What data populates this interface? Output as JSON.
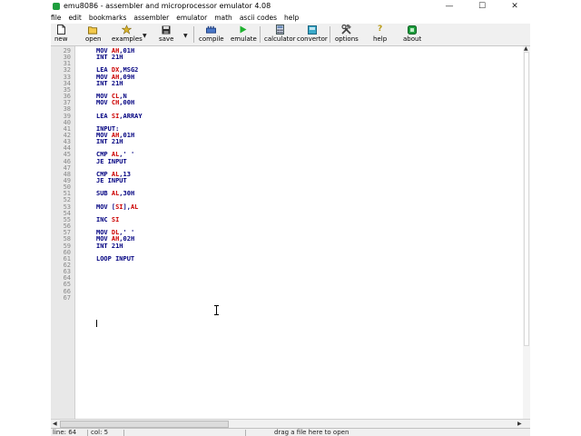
{
  "window": {
    "title": "emu8086 - assembler and microprocessor emulator 4.08",
    "minimize_glyph": "—",
    "maximize_glyph": "☐",
    "close_glyph": "✕"
  },
  "menu": [
    "file",
    "edit",
    "bookmarks",
    "assembler",
    "emulator",
    "math",
    "ascii codes",
    "help"
  ],
  "toolbar": {
    "new": "new",
    "open": "open",
    "examples": "examples",
    "save": "save",
    "compile": "compile",
    "emulate": "emulate",
    "calculator": "calculator",
    "convertor": "convertor",
    "options": "options",
    "help": "help",
    "about": "about",
    "dropdown_glyph": "▼"
  },
  "editor": {
    "lines": [
      {
        "num": "29",
        "text": "MOV AH,01H"
      },
      {
        "num": "30",
        "text": "INT 21H"
      },
      {
        "num": "31",
        "text": ""
      },
      {
        "num": "32",
        "text": "LEA DX,MSG2"
      },
      {
        "num": "33",
        "text": "MOV AH,09H"
      },
      {
        "num": "34",
        "text": "INT 21H"
      },
      {
        "num": "35",
        "text": ""
      },
      {
        "num": "36",
        "text": "MOV CL,N"
      },
      {
        "num": "37",
        "text": "MOV CH,00H"
      },
      {
        "num": "38",
        "text": ""
      },
      {
        "num": "39",
        "text": "LEA SI,ARRAY"
      },
      {
        "num": "40",
        "text": ""
      },
      {
        "num": "41",
        "text": "INPUT:"
      },
      {
        "num": "42",
        "text": "MOV AH,01H"
      },
      {
        "num": "43",
        "text": "INT 21H"
      },
      {
        "num": "44",
        "text": ""
      },
      {
        "num": "45",
        "text": "CMP AL,' '"
      },
      {
        "num": "46",
        "text": "JE INPUT"
      },
      {
        "num": "47",
        "text": ""
      },
      {
        "num": "48",
        "text": "CMP AL,13"
      },
      {
        "num": "49",
        "text": "JE INPUT"
      },
      {
        "num": "50",
        "text": ""
      },
      {
        "num": "51",
        "text": "SUB AL,30H"
      },
      {
        "num": "52",
        "text": ""
      },
      {
        "num": "53",
        "text": "MOV [SI],AL"
      },
      {
        "num": "54",
        "text": ""
      },
      {
        "num": "55",
        "text": "INC SI"
      },
      {
        "num": "56",
        "text": ""
      },
      {
        "num": "57",
        "text": "MOV DL,' '"
      },
      {
        "num": "58",
        "text": "MOV AH,02H"
      },
      {
        "num": "59",
        "text": "INT 21H"
      },
      {
        "num": "60",
        "text": ""
      },
      {
        "num": "61",
        "text": "LOOP INPUT"
      },
      {
        "num": "62",
        "text": ""
      },
      {
        "num": "63",
        "text": ""
      },
      {
        "num": "64",
        "text": ""
      },
      {
        "num": "65",
        "text": ""
      },
      {
        "num": "66",
        "text": ""
      },
      {
        "num": "67",
        "text": ""
      }
    ]
  },
  "scroll": {
    "up_glyph": "▲",
    "left_glyph": "◀",
    "right_glyph": "▶"
  },
  "status": {
    "line": "line: 64",
    "col": "col: 5",
    "hint": "drag a file here to open"
  },
  "colors": {
    "keyword": "#000080",
    "register": "#cc0000"
  }
}
